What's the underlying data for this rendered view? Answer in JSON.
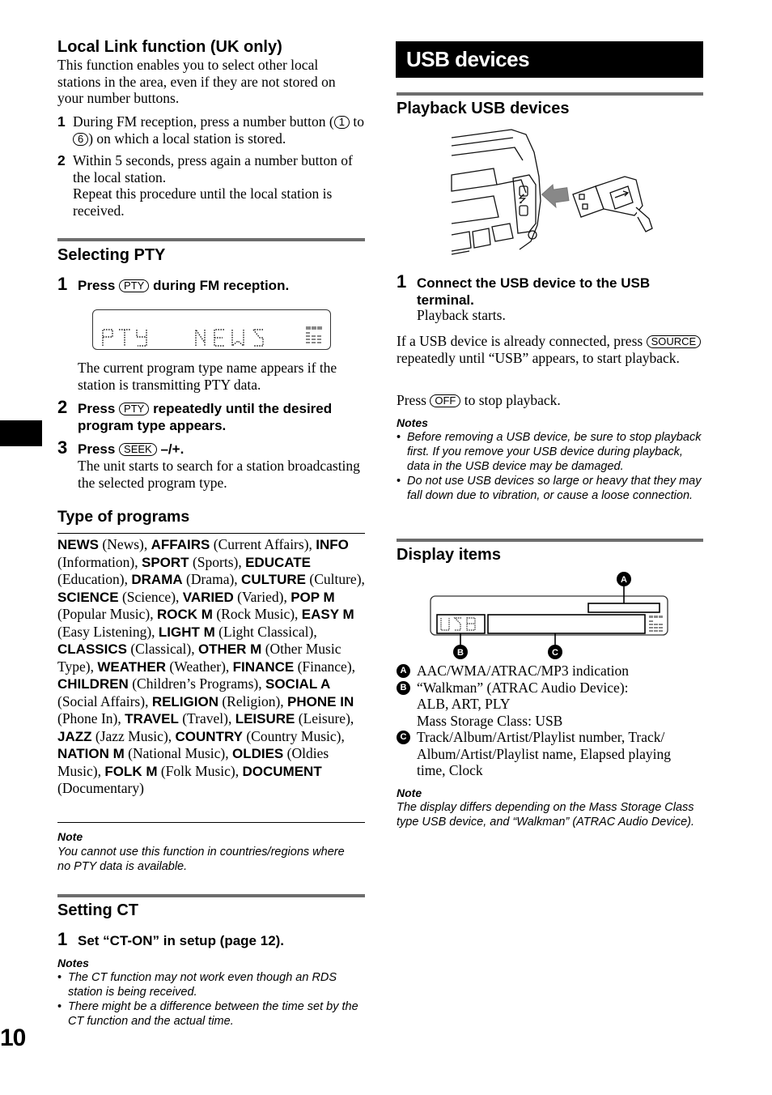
{
  "page": {
    "number": "10"
  },
  "left": {
    "local_link": {
      "title": "Local Link function (UK only)",
      "intro": "This function enables you to select other local stations in the area, even if they are not stored on your number buttons.",
      "steps": [
        {
          "num": "1",
          "pre": "During FM reception, press a number button (",
          "btn1": "1",
          "mid": " to ",
          "btn2": "6",
          "post": ") on which a local station is stored."
        },
        {
          "num": "2",
          "text": "Within 5 seconds, press again a number button of the local station.",
          "sub": "Repeat this procedure until the local station is received."
        }
      ]
    },
    "selecting_pty": {
      "title": "Selecting PTY",
      "steps": [
        {
          "num": "1",
          "pre": "Press ",
          "btn": "PTY",
          "post": " during FM reception."
        },
        {
          "num": "2",
          "pre": "Press ",
          "btn": "PTY",
          "post": " repeatedly until the desired program type appears."
        },
        {
          "num": "3",
          "pre": "Press ",
          "btn": "SEEK",
          "post": " –/+."
        }
      ],
      "lcd": {
        "left_text": "PTY",
        "right_text": "NEWS",
        "eq_label": "EQ3"
      },
      "step1_desc": "The current program type name appears if the station is transmitting PTY data.",
      "step3_desc": "The unit starts to search for a station broadcasting the selected program type."
    },
    "type_of_programs": {
      "title": "Type of programs",
      "items": [
        {
          "code": "NEWS",
          "desc": "(News)"
        },
        {
          "code": "AFFAIRS",
          "desc": "(Current Affairs)"
        },
        {
          "code": "INFO",
          "desc": "(Information)"
        },
        {
          "code": "SPORT",
          "desc": "(Sports)"
        },
        {
          "code": "EDUCATE",
          "desc": "(Education)"
        },
        {
          "code": "DRAMA",
          "desc": "(Drama)"
        },
        {
          "code": "CULTURE",
          "desc": "(Culture)"
        },
        {
          "code": "SCIENCE",
          "desc": "(Science)"
        },
        {
          "code": "VARIED",
          "desc": "(Varied)"
        },
        {
          "code": "POP M",
          "desc": "(Popular Music)"
        },
        {
          "code": "ROCK M",
          "desc": "(Rock Music)"
        },
        {
          "code": "EASY M",
          "desc": "(Easy Listening)"
        },
        {
          "code": "LIGHT M",
          "desc": "(Light Classical)"
        },
        {
          "code": "CLASSICS",
          "desc": "(Classical)"
        },
        {
          "code": "OTHER M",
          "desc": "(Other Music Type)"
        },
        {
          "code": "WEATHER",
          "desc": "(Weather)"
        },
        {
          "code": "FINANCE",
          "desc": "(Finance)"
        },
        {
          "code": "CHILDREN",
          "desc": "(Children’s Programs)"
        },
        {
          "code": "SOCIAL A",
          "desc": "(Social Affairs)"
        },
        {
          "code": "RELIGION",
          "desc": "(Religion)"
        },
        {
          "code": "PHONE IN",
          "desc": "(Phone In)"
        },
        {
          "code": "TRAVEL",
          "desc": "(Travel)"
        },
        {
          "code": "LEISURE",
          "desc": "(Leisure)"
        },
        {
          "code": "JAZZ",
          "desc": "(Jazz Music)"
        },
        {
          "code": "COUNTRY",
          "desc": "(Country Music)"
        },
        {
          "code": "NATION M",
          "desc": "(National Music)"
        },
        {
          "code": "OLDIES",
          "desc": "(Oldies Music)"
        },
        {
          "code": "FOLK M",
          "desc": "(Folk Music)"
        },
        {
          "code": "DOCUMENT",
          "desc": "(Documentary)"
        }
      ],
      "note_heading": "Note",
      "note": "You cannot use this function in countries/regions where no PTY data is available."
    },
    "setting_ct": {
      "title": "Setting CT",
      "step": {
        "num": "1",
        "text": "Set “CT-ON” in setup (page 12)."
      },
      "notes_heading": "Notes",
      "notes": [
        "The CT function may not work even though an RDS station is being received.",
        "There might be a difference between the time set by the CT function and the actual time."
      ]
    }
  },
  "right": {
    "banner": "USB devices",
    "playback": {
      "title": "Playback USB devices",
      "step": {
        "num": "1",
        "text": "Connect the USB device to the USB terminal.",
        "sub": "Playback starts."
      },
      "para1": {
        "pre": "If a USB device is already connected, press ",
        "btn": "SOURCE",
        "post": " repeatedly until “USB” appears, to start playback."
      },
      "para2": {
        "pre": "Press ",
        "btn": "OFF",
        "post": " to stop playback."
      },
      "notes_heading": "Notes",
      "notes": [
        "Before removing a USB device, be sure to stop playback first. If you remove your USB device during playback, data in the USB device may be damaged.",
        "Do not use USB devices so large or heavy that they may fall down due to vibration, or cause a loose connection."
      ]
    },
    "display_items": {
      "title": "Display items",
      "lcd": {
        "left_text": "USB",
        "eq_label": "EQ3"
      },
      "callouts": [
        "A",
        "B",
        "C"
      ],
      "legend": [
        {
          "mark": "A",
          "lines": [
            "AAC/WMA/ATRAC/MP3 indication"
          ]
        },
        {
          "mark": "B",
          "lines": [
            "“Walkman” (ATRAC Audio Device):",
            "ALB, ART, PLY",
            "Mass Storage Class: USB"
          ]
        },
        {
          "mark": "C",
          "lines": [
            "Track/Album/Artist/Playlist number, Track/",
            "Album/Artist/Playlist name, Elapsed playing",
            "time, Clock"
          ]
        }
      ],
      "note_heading": "Note",
      "note": "The display differs depending on the Mass Storage Class type USB device, and “Walkman” (ATRAC Audio Device)."
    }
  }
}
